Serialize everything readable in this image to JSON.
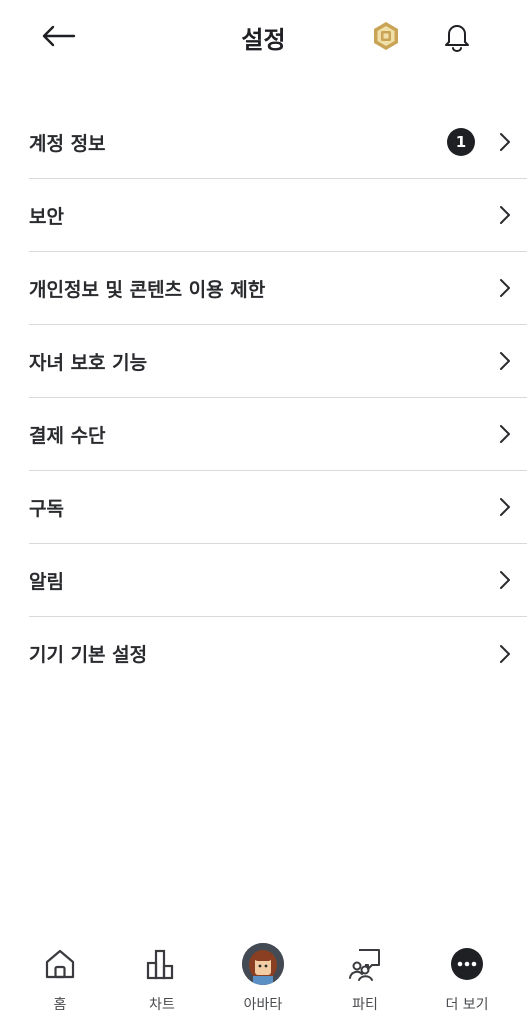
{
  "header": {
    "title": "설정",
    "back_icon": "arrow-left-icon",
    "robux_icon": "robux-icon",
    "bell_icon": "bell-icon",
    "robux_color": "#c9a456"
  },
  "menu": [
    {
      "label": "계정 정보",
      "badge": "1"
    },
    {
      "label": "보안"
    },
    {
      "label": "개인정보 및 콘텐츠 이용 제한"
    },
    {
      "label": "자녀 보호 기능"
    },
    {
      "label": "결제 수단"
    },
    {
      "label": "구독"
    },
    {
      "label": "알림"
    },
    {
      "label": "기기 기본 설정"
    }
  ],
  "bottom_nav": [
    {
      "label": "홈",
      "icon": "home-icon"
    },
    {
      "label": "차트",
      "icon": "chart-icon"
    },
    {
      "label": "아바타",
      "icon": "avatar"
    },
    {
      "label": "파티",
      "icon": "party-icon"
    },
    {
      "label": "더 보기",
      "icon": "more-icon"
    }
  ]
}
